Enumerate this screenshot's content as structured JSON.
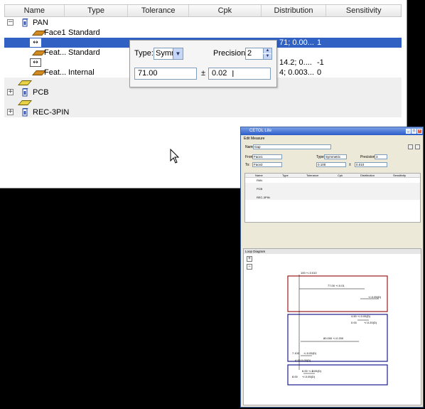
{
  "columns": [
    "Name",
    "Type",
    "Tolerance",
    "Cpk",
    "Distribution",
    "Sensitivity"
  ],
  "tree": [
    {
      "key": "pan",
      "name": "PAN",
      "type": "",
      "distribution": "",
      "sensitivity": "",
      "expander": "−"
    },
    {
      "key": "face1",
      "name": "Face1",
      "type": "Standard",
      "distribution": "",
      "sensitivity": ""
    },
    {
      "key": "meas1",
      "name": "",
      "type": "",
      "distribution": "71; 0.00...",
      "sensitivity": "1"
    },
    {
      "key": "feat1",
      "name": "Feat...",
      "type": "Standard",
      "distribution": "",
      "sensitivity": ""
    },
    {
      "key": "meas2",
      "name": "",
      "type": "",
      "distribution": "14.2; 0....",
      "sensitivity": "-1"
    },
    {
      "key": "feat2",
      "name": "Feat...",
      "type": "Internal",
      "distribution": "4; 0.003...",
      "sensitivity": "0"
    },
    {
      "key": "blank1",
      "name": "",
      "type": "",
      "distribution": "",
      "sensitivity": ""
    },
    {
      "key": "pcb",
      "name": "PCB",
      "type": "",
      "distribution": "",
      "sensitivity": "",
      "expander": "+"
    },
    {
      "key": "blank2",
      "name": "",
      "type": "",
      "distribution": "",
      "sensitivity": ""
    },
    {
      "key": "rec3pin",
      "name": "REC-3PIN",
      "type": "",
      "distribution": "",
      "sensitivity": "",
      "expander": "+"
    }
  ],
  "popup": {
    "type_label": "Type:",
    "type_value": "Symm",
    "precision_label": "Precision:",
    "precision_value": "2",
    "nominal_value": "71.00",
    "pm_symbol": "±",
    "tolerance_value": "0.02"
  },
  "thumbnail": {
    "window_title": "CETOL Lite",
    "edit_measure": "Edit Measure",
    "name_label": "Name:",
    "name_value": "Gap",
    "from_label": "From:",
    "from_value": "Face1",
    "to_label": "To:",
    "to_value": "Face2",
    "type_label": "Type:",
    "type_value": "Symmetric",
    "precision_label": "Precision:",
    "precision_value": "3",
    "nominal_value": "0.100",
    "pm_symbol": "±",
    "tolerance_value": "0.010",
    "grid_columns": [
      "Name",
      "Type",
      "Tolerance",
      "Cpk",
      "Distribution",
      "Sensitivity"
    ],
    "grid_rows": [
      "PAN",
      "",
      "PCB",
      "",
      "REC-3PIN"
    ],
    "loop_title": "Loop Diagram",
    "dims": [
      "100 +/-0.010",
      "77.00 +/-0.01",
      "+/-0.05(D)",
      "4.50 +/-0.05(D)",
      "0.00",
      "+/-0.20(D)",
      "80.000 +/-0.200",
      "7.100",
      "+/-0.05(D)",
      "4.00 0.05(D)",
      "6.00 +/-0.05(D)",
      "8.00",
      "+/-0.05(D)",
      "2"
    ]
  },
  "colors": {
    "selection": "#3162c3",
    "loop_box_1": "#9c1a1a",
    "loop_box_2": "#1c1c8c",
    "loop_box_3": "#1c1c8c"
  }
}
